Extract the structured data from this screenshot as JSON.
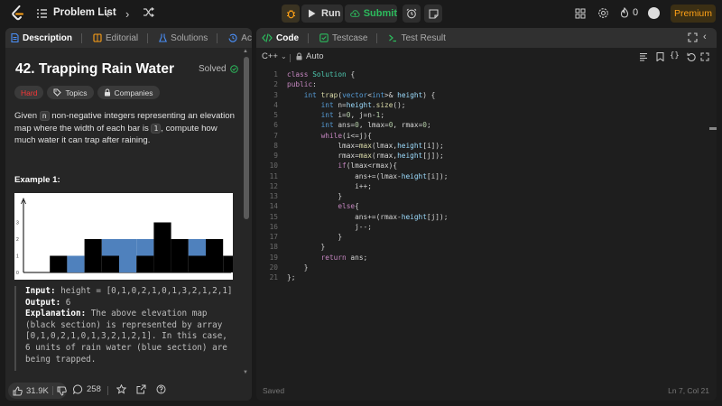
{
  "header": {
    "problem_list_label": "Problem List",
    "run_label": "Run",
    "submit_label": "Submit",
    "streak_count": "0",
    "premium_label": "Premium"
  },
  "left_tabs": [
    {
      "label": "Description"
    },
    {
      "label": "Editorial"
    },
    {
      "label": "Solutions"
    },
    {
      "label": "Accepted"
    }
  ],
  "problem": {
    "title": "42. Trapping Rain Water",
    "status": "Solved",
    "difficulty": "Hard",
    "topics_label": "Topics",
    "companies_label": "Companies",
    "desc_part1": "Given ",
    "desc_n": "n",
    "desc_part2": " non-negative integers representing an elevation map where the width of each bar is ",
    "desc_1": "1",
    "desc_part3": ", compute how much water it can trap after raining.",
    "example_title": "Example 1:",
    "example_input_label": "Input:",
    "example_input": "height = [0,1,0,2,1,0,1,3,2,1,2,1]",
    "example_output_label": "Output:",
    "example_output": "6",
    "example_expl_label": "Explanation:",
    "example_expl": "The above elevation map (black section) is represented by array [0,1,0,2,1,0,1,3,2,1,2,1]. In this case, 6 units of rain water (blue section) are being trapped.",
    "elevation": [
      0,
      1,
      0,
      2,
      1,
      0,
      1,
      3,
      2,
      1,
      2,
      1
    ],
    "water": [
      0,
      0,
      1,
      0,
      1,
      2,
      1,
      0,
      0,
      1,
      0,
      0
    ],
    "axis_ticks": [
      "0",
      "1",
      "2",
      "3"
    ]
  },
  "left_footer": {
    "likes": "31.9K",
    "comments": "258"
  },
  "right_tabs": [
    {
      "label": "Code"
    },
    {
      "label": "Testcase"
    },
    {
      "label": "Test Result"
    }
  ],
  "editor": {
    "language": "C++",
    "mode": "Auto",
    "saved_label": "Saved",
    "cursor_pos": "Ln 7, Col 21"
  },
  "code_lines": [
    "class Solution {",
    "public:",
    "    int trap(vector<int>& height) {",
    "        int n=height.size();",
    "        int i=0, j=n-1;",
    "        int ans=0, lmax=0, rmax=0;",
    "        while(i<=j){",
    "            lmax=max(lmax,height[i]);",
    "            rmax=max(rmax,height[j]);",
    "            if(lmax<rmax){",
    "                ans+=(lmax-height[i]);",
    "                i++;",
    "            }",
    "            else{",
    "                ans+=(rmax-height[j]);",
    "                j--;",
    "            }",
    "        }",
    "        return ans;",
    "    }",
    "};"
  ],
  "colors": {
    "accent_orange": "#ffa116",
    "submit_green": "#2cbb5d",
    "hard_red": "#f63737",
    "water_blue": "#4f81bd"
  }
}
